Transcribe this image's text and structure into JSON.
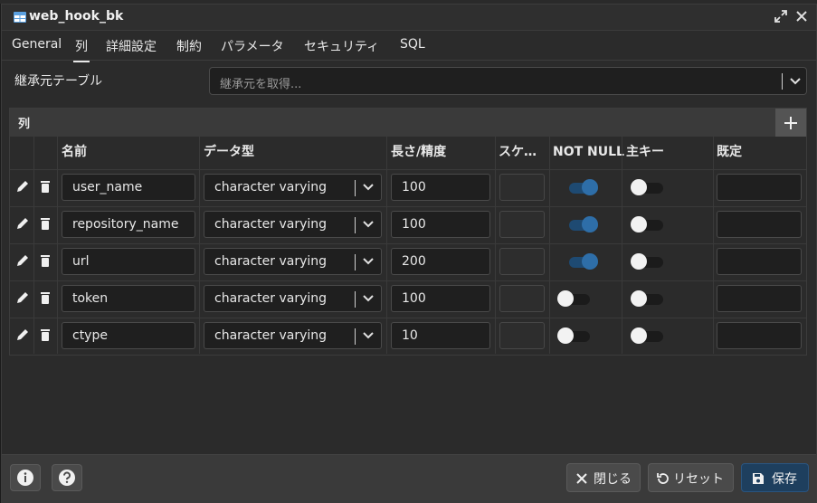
{
  "window": {
    "title": "web_hook_bk"
  },
  "tabs": [
    "General",
    "列",
    "詳細設定",
    "制約",
    "パラメータ",
    "セキュリティ",
    "SQL"
  ],
  "inherit": {
    "label": "継承元テーブル",
    "placeholder": "継承元を取得..."
  },
  "columns_panel": {
    "title": "列",
    "headers": {
      "name": "名前",
      "type": "データ型",
      "length": "長さ/精度",
      "scale": "スケ…",
      "not_null": "NOT NULL",
      "pk": "主キー",
      "default": "既定"
    },
    "rows": [
      {
        "name": "user_name",
        "type": "character varying",
        "length": "100",
        "not_null": true,
        "pk": false
      },
      {
        "name": "repository_name",
        "type": "character varying",
        "length": "100",
        "not_null": true,
        "pk": false
      },
      {
        "name": "url",
        "type": "character varying",
        "length": "200",
        "not_null": true,
        "pk": false
      },
      {
        "name": "token",
        "type": "character varying",
        "length": "100",
        "not_null": false,
        "pk": false
      },
      {
        "name": "ctype",
        "type": "character varying",
        "length": "10",
        "not_null": false,
        "pk": false
      }
    ]
  },
  "footer": {
    "close": "閉じる",
    "reset": "リセット",
    "save": "保存"
  },
  "colors": {
    "accent": "#2e6ea8",
    "save_button": "#1e3f5e",
    "background": "#2b2b2b"
  }
}
